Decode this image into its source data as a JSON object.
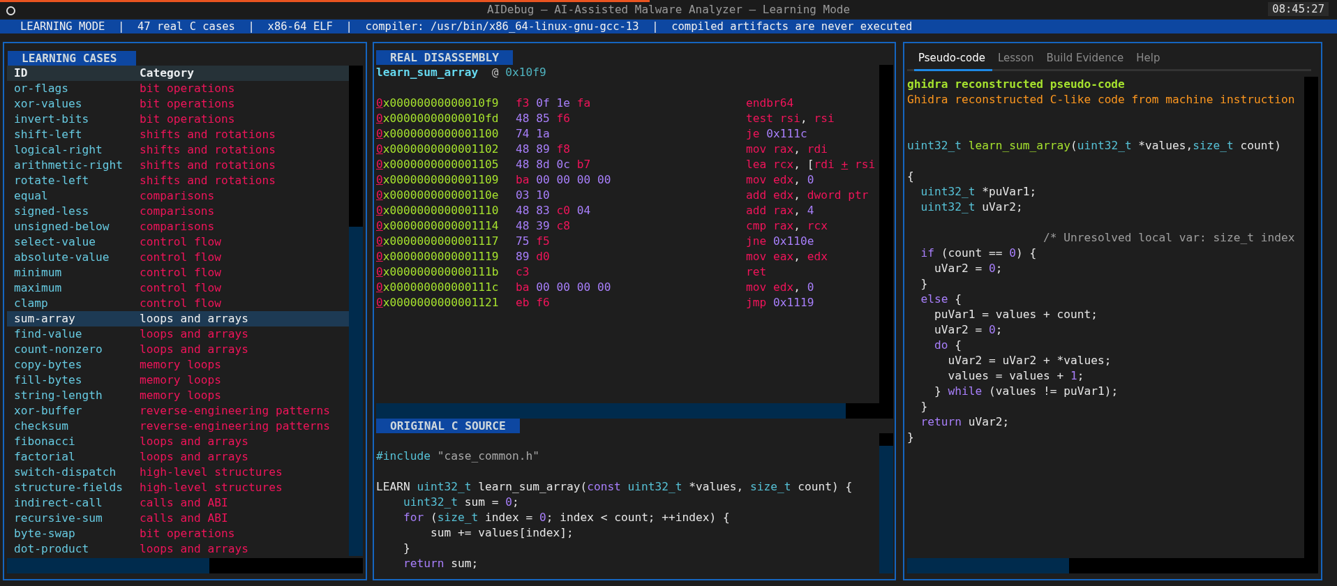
{
  "title_bar": {
    "title": "AIDebug — AI-Assisted Malware Analyzer — Learning Mode",
    "time": "08:45:27"
  },
  "status_bar": "LEARNING MODE  |  47 real C cases  |  x86-64 ELF  |  compiler: /usr/bin/x86_64-linux-gnu-gcc-13  |  compiled artifacts are never executed",
  "cases": {
    "title": "LEARNING CASES",
    "columns": [
      "ID",
      "Category"
    ],
    "rows": [
      {
        "id": "or-flags",
        "category": "bit operations",
        "selected": false
      },
      {
        "id": "xor-values",
        "category": "bit operations",
        "selected": false
      },
      {
        "id": "invert-bits",
        "category": "bit operations",
        "selected": false
      },
      {
        "id": "shift-left",
        "category": "shifts and rotations",
        "selected": false
      },
      {
        "id": "logical-right",
        "category": "shifts and rotations",
        "selected": false
      },
      {
        "id": "arithmetic-right",
        "category": "shifts and rotations",
        "selected": false
      },
      {
        "id": "rotate-left",
        "category": "shifts and rotations",
        "selected": false
      },
      {
        "id": "equal",
        "category": "comparisons",
        "selected": false
      },
      {
        "id": "signed-less",
        "category": "comparisons",
        "selected": false
      },
      {
        "id": "unsigned-below",
        "category": "comparisons",
        "selected": false
      },
      {
        "id": "select-value",
        "category": "control flow",
        "selected": false
      },
      {
        "id": "absolute-value",
        "category": "control flow",
        "selected": false
      },
      {
        "id": "minimum",
        "category": "control flow",
        "selected": false
      },
      {
        "id": "maximum",
        "category": "control flow",
        "selected": false
      },
      {
        "id": "clamp",
        "category": "control flow",
        "selected": false
      },
      {
        "id": "sum-array",
        "category": "loops and arrays",
        "selected": true
      },
      {
        "id": "find-value",
        "category": "loops and arrays",
        "selected": false
      },
      {
        "id": "count-nonzero",
        "category": "loops and arrays",
        "selected": false
      },
      {
        "id": "copy-bytes",
        "category": "memory loops",
        "selected": false
      },
      {
        "id": "fill-bytes",
        "category": "memory loops",
        "selected": false
      },
      {
        "id": "string-length",
        "category": "memory loops",
        "selected": false
      },
      {
        "id": "xor-buffer",
        "category": "reverse-engineering patterns",
        "selected": false
      },
      {
        "id": "checksum",
        "category": "reverse-engineering patterns",
        "selected": false
      },
      {
        "id": "fibonacci",
        "category": "loops and arrays",
        "selected": false
      },
      {
        "id": "factorial",
        "category": "loops and arrays",
        "selected": false
      },
      {
        "id": "switch-dispatch",
        "category": "high-level structures",
        "selected": false
      },
      {
        "id": "structure-fields",
        "category": "high-level structures",
        "selected": false
      },
      {
        "id": "indirect-call",
        "category": "calls and ABI",
        "selected": false
      },
      {
        "id": "recursive-sum",
        "category": "calls and ABI",
        "selected": false
      },
      {
        "id": "byte-swap",
        "category": "bit operations",
        "selected": false
      },
      {
        "id": "dot-product",
        "category": "loops and arrays",
        "selected": false
      }
    ]
  },
  "disassembly": {
    "title": "REAL DISASSEMBLY",
    "function": "learn_sum_array",
    "at": "@",
    "address": "0x10f9",
    "rows": [
      {
        "address": [
          {
            "text": "0",
            "kind": "mark"
          },
          {
            "text": "x00000000000010f9",
            "kind": "addr"
          }
        ],
        "bytes": [
          {
            "text": "f3",
            "kind": "op"
          },
          {
            "text": "0f",
            "kind": "num"
          },
          {
            "text": "1e",
            "kind": "num"
          },
          {
            "text": "fa",
            "kind": "op"
          }
        ],
        "instruction": [
          {
            "text": "endbr64",
            "kind": "op"
          }
        ]
      },
      {
        "address": [
          {
            "text": "0",
            "kind": "mark"
          },
          {
            "text": "x00000000000010fd",
            "kind": "addr"
          }
        ],
        "bytes": [
          {
            "text": "48",
            "kind": "num"
          },
          {
            "text": "85",
            "kind": "num"
          },
          {
            "text": "f6",
            "kind": "op"
          }
        ],
        "instruction": [
          {
            "text": "test rsi",
            "kind": "op"
          },
          {
            "text": ", ",
            "kind": "plain"
          },
          {
            "text": "rsi",
            "kind": "op"
          }
        ]
      },
      {
        "address": [
          {
            "text": "0",
            "kind": "mark"
          },
          {
            "text": "x0000000000001100",
            "kind": "addr"
          }
        ],
        "bytes": [
          {
            "text": "74",
            "kind": "num"
          },
          {
            "text": "1a",
            "kind": "num"
          }
        ],
        "instruction": [
          {
            "text": "je",
            "kind": "op"
          },
          {
            "text": " 0x111c",
            "kind": "num"
          }
        ]
      },
      {
        "address": [
          {
            "text": "0",
            "kind": "mark"
          },
          {
            "text": "x0000000000001102",
            "kind": "addr"
          }
        ],
        "bytes": [
          {
            "text": "48",
            "kind": "num"
          },
          {
            "text": "89",
            "kind": "num"
          },
          {
            "text": "f8",
            "kind": "op"
          }
        ],
        "instruction": [
          {
            "text": "mov rax",
            "kind": "op"
          },
          {
            "text": ", ",
            "kind": "plain"
          },
          {
            "text": "rdi",
            "kind": "op"
          }
        ]
      },
      {
        "address": [
          {
            "text": "0",
            "kind": "mark"
          },
          {
            "text": "x0000000000001105",
            "kind": "addr"
          }
        ],
        "bytes": [
          {
            "text": "48",
            "kind": "num"
          },
          {
            "text": "8d",
            "kind": "num"
          },
          {
            "text": "0c",
            "kind": "num"
          },
          {
            "text": "b7",
            "kind": "op"
          }
        ],
        "instruction": [
          {
            "text": "lea rcx",
            "kind": "op"
          },
          {
            "text": ", [",
            "kind": "plain"
          },
          {
            "text": "rdi ",
            "kind": "op"
          },
          {
            "text": "+",
            "kind": "mark"
          },
          {
            "text": " rsi",
            "kind": "op"
          }
        ]
      },
      {
        "address": [
          {
            "text": "0",
            "kind": "mark"
          },
          {
            "text": "x0000000000001109",
            "kind": "addr"
          }
        ],
        "bytes": [
          {
            "text": "ba",
            "kind": "op"
          },
          {
            "text": "00",
            "kind": "num"
          },
          {
            "text": "00",
            "kind": "num"
          },
          {
            "text": "00",
            "kind": "num"
          },
          {
            "text": "00",
            "kind": "num"
          }
        ],
        "instruction": [
          {
            "text": "mov edx",
            "kind": "op"
          },
          {
            "text": ", ",
            "kind": "plain"
          },
          {
            "text": "0",
            "kind": "num"
          }
        ]
      },
      {
        "address": [
          {
            "text": "0",
            "kind": "mark"
          },
          {
            "text": "x000000000000110e",
            "kind": "addr"
          }
        ],
        "bytes": [
          {
            "text": "03",
            "kind": "num"
          },
          {
            "text": "10",
            "kind": "num"
          }
        ],
        "instruction": [
          {
            "text": "add edx",
            "kind": "op"
          },
          {
            "text": ", ",
            "kind": "plain"
          },
          {
            "text": "dword ptr",
            "kind": "op"
          }
        ]
      },
      {
        "address": [
          {
            "text": "0",
            "kind": "mark"
          },
          {
            "text": "x0000000000001110",
            "kind": "addr"
          }
        ],
        "bytes": [
          {
            "text": "48",
            "kind": "num"
          },
          {
            "text": "83",
            "kind": "num"
          },
          {
            "text": "c0",
            "kind": "op"
          },
          {
            "text": "04",
            "kind": "num"
          }
        ],
        "instruction": [
          {
            "text": "add rax",
            "kind": "op"
          },
          {
            "text": ", ",
            "kind": "plain"
          },
          {
            "text": "4",
            "kind": "num"
          }
        ]
      },
      {
        "address": [
          {
            "text": "0",
            "kind": "mark"
          },
          {
            "text": "x0000000000001114",
            "kind": "addr"
          }
        ],
        "bytes": [
          {
            "text": "48",
            "kind": "num"
          },
          {
            "text": "39",
            "kind": "num"
          },
          {
            "text": "c8",
            "kind": "op"
          }
        ],
        "instruction": [
          {
            "text": "cmp rax",
            "kind": "op"
          },
          {
            "text": ", ",
            "kind": "plain"
          },
          {
            "text": "rcx",
            "kind": "op"
          }
        ]
      },
      {
        "address": [
          {
            "text": "0",
            "kind": "mark"
          },
          {
            "text": "x0000000000001117",
            "kind": "addr"
          }
        ],
        "bytes": [
          {
            "text": "75",
            "kind": "num"
          },
          {
            "text": "f5",
            "kind": "op"
          }
        ],
        "instruction": [
          {
            "text": "jne",
            "kind": "op"
          },
          {
            "text": " 0x110e",
            "kind": "num"
          }
        ]
      },
      {
        "address": [
          {
            "text": "0",
            "kind": "mark"
          },
          {
            "text": "x0000000000001119",
            "kind": "addr"
          }
        ],
        "bytes": [
          {
            "text": "89",
            "kind": "num"
          },
          {
            "text": "d0",
            "kind": "op"
          }
        ],
        "instruction": [
          {
            "text": "mov eax",
            "kind": "op"
          },
          {
            "text": ", ",
            "kind": "plain"
          },
          {
            "text": "edx",
            "kind": "op"
          }
        ]
      },
      {
        "address": [
          {
            "text": "0",
            "kind": "mark"
          },
          {
            "text": "x000000000000111b",
            "kind": "addr"
          }
        ],
        "bytes": [
          {
            "text": "c3",
            "kind": "op"
          }
        ],
        "instruction": [
          {
            "text": "ret",
            "kind": "op"
          }
        ]
      },
      {
        "address": [
          {
            "text": "0",
            "kind": "mark"
          },
          {
            "text": "x000000000000111c",
            "kind": "addr"
          }
        ],
        "bytes": [
          {
            "text": "ba",
            "kind": "op"
          },
          {
            "text": "00",
            "kind": "num"
          },
          {
            "text": "00",
            "kind": "num"
          },
          {
            "text": "00",
            "kind": "num"
          },
          {
            "text": "00",
            "kind": "num"
          }
        ],
        "instruction": [
          {
            "text": "mov edx",
            "kind": "op"
          },
          {
            "text": ", ",
            "kind": "plain"
          },
          {
            "text": "0",
            "kind": "num"
          }
        ]
      },
      {
        "address": [
          {
            "text": "0",
            "kind": "mark"
          },
          {
            "text": "x0000000000001121",
            "kind": "addr"
          }
        ],
        "bytes": [
          {
            "text": "eb",
            "kind": "op"
          },
          {
            "text": "f6",
            "kind": "op"
          }
        ],
        "instruction": [
          {
            "text": "jmp",
            "kind": "op"
          },
          {
            "text": " 0x1119",
            "kind": "num"
          }
        ]
      }
    ]
  },
  "source": {
    "title": "ORIGINAL C SOURCE",
    "lines": [
      {
        "kind": "code",
        "tokens": [
          {
            "text": "#include",
            "kind": "type"
          },
          {
            "text": " \"case_common.h\"",
            "kind": "str"
          }
        ]
      },
      {
        "kind": "blank"
      },
      {
        "kind": "code",
        "tokens": [
          {
            "text": "LEARN ",
            "kind": "plain"
          },
          {
            "text": "uint32_t",
            "kind": "type"
          },
          {
            "text": " learn_sum_array(",
            "kind": "plain"
          },
          {
            "text": "const",
            "kind": "kw"
          },
          {
            "text": " uint32_t",
            "kind": "type"
          },
          {
            "text": " *values, ",
            "kind": "plain"
          },
          {
            "text": "size_t",
            "kind": "type"
          },
          {
            "text": " count) {",
            "kind": "plain"
          }
        ]
      },
      {
        "kind": "code",
        "tokens": [
          {
            "text": "    uint32_t",
            "kind": "type"
          },
          {
            "text": " sum = ",
            "kind": "plain"
          },
          {
            "text": "0",
            "kind": "kw"
          },
          {
            "text": ";",
            "kind": "plain"
          }
        ]
      },
      {
        "kind": "code",
        "tokens": [
          {
            "text": "    for",
            "kind": "kw"
          },
          {
            "text": " (",
            "kind": "plain"
          },
          {
            "text": "size_t",
            "kind": "type"
          },
          {
            "text": " index = ",
            "kind": "plain"
          },
          {
            "text": "0",
            "kind": "kw"
          },
          {
            "text": "; index < count; ++index) {",
            "kind": "plain"
          }
        ]
      },
      {
        "kind": "code",
        "tokens": [
          {
            "text": "        sum += values[index];",
            "kind": "plain"
          }
        ]
      },
      {
        "kind": "code",
        "tokens": [
          {
            "text": "    }",
            "kind": "plain"
          }
        ]
      },
      {
        "kind": "code",
        "tokens": [
          {
            "text": "    return",
            "kind": "kw"
          },
          {
            "text": " sum;",
            "kind": "plain"
          }
        ]
      }
    ]
  },
  "tabs": [
    {
      "label": "Pseudo-code",
      "selected": true
    },
    {
      "label": "Lesson",
      "selected": false
    },
    {
      "label": "Build Evidence",
      "selected": false
    },
    {
      "label": "Help",
      "selected": false
    }
  ],
  "pseudo_code": {
    "lines": [
      {
        "kind": "code",
        "tokens": [
          {
            "text": "ghidra reconstructed pseudo-code",
            "kind": "heading"
          }
        ]
      },
      {
        "kind": "code",
        "tokens": [
          {
            "text": "Ghidra reconstructed C-like code from machine instruction",
            "kind": "note"
          }
        ]
      },
      {
        "kind": "blank"
      },
      {
        "kind": "blank"
      },
      {
        "kind": "code",
        "tokens": [
          {
            "text": "uint32_t",
            "kind": "type"
          },
          {
            "text": " learn_sum_array",
            "kind": "fn"
          },
          {
            "text": "(",
            "kind": "plain"
          },
          {
            "text": "uint32_t",
            "kind": "type"
          },
          {
            "text": " *values,",
            "kind": "plain"
          },
          {
            "text": "size_t",
            "kind": "type"
          },
          {
            "text": " count)",
            "kind": "plain"
          }
        ]
      },
      {
        "kind": "blank"
      },
      {
        "kind": "code",
        "tokens": [
          {
            "text": "{",
            "kind": "plain"
          }
        ]
      },
      {
        "kind": "code",
        "tokens": [
          {
            "text": "  uint32_t",
            "kind": "type"
          },
          {
            "text": " *puVar1;",
            "kind": "plain"
          }
        ]
      },
      {
        "kind": "code",
        "tokens": [
          {
            "text": "  uint32_t",
            "kind": "type"
          },
          {
            "text": " uVar2;",
            "kind": "plain"
          }
        ]
      },
      {
        "kind": "blank"
      },
      {
        "kind": "code",
        "tokens": [
          {
            "text": "                    /* Unresolved local var: size_t index",
            "kind": "comment"
          }
        ]
      },
      {
        "kind": "code",
        "tokens": [
          {
            "text": "  if",
            "kind": "kw"
          },
          {
            "text": " (count == ",
            "kind": "plain"
          },
          {
            "text": "0",
            "kind": "kw"
          },
          {
            "text": ") {",
            "kind": "plain"
          }
        ]
      },
      {
        "kind": "code",
        "tokens": [
          {
            "text": "    uVar2 = ",
            "kind": "plain"
          },
          {
            "text": "0",
            "kind": "kw"
          },
          {
            "text": ";",
            "kind": "plain"
          }
        ]
      },
      {
        "kind": "code",
        "tokens": [
          {
            "text": "  }",
            "kind": "plain"
          }
        ]
      },
      {
        "kind": "code",
        "tokens": [
          {
            "text": "  else",
            "kind": "kw"
          },
          {
            "text": " {",
            "kind": "plain"
          }
        ]
      },
      {
        "kind": "code",
        "tokens": [
          {
            "text": "    puVar1 = values + count;",
            "kind": "plain"
          }
        ]
      },
      {
        "kind": "code",
        "tokens": [
          {
            "text": "    uVar2 = ",
            "kind": "plain"
          },
          {
            "text": "0",
            "kind": "kw"
          },
          {
            "text": ";",
            "kind": "plain"
          }
        ]
      },
      {
        "kind": "code",
        "tokens": [
          {
            "text": "    do",
            "kind": "kw"
          },
          {
            "text": " {",
            "kind": "plain"
          }
        ]
      },
      {
        "kind": "code",
        "tokens": [
          {
            "text": "      uVar2 = uVar2 + *values;",
            "kind": "plain"
          }
        ]
      },
      {
        "kind": "code",
        "tokens": [
          {
            "text": "      values = values + ",
            "kind": "plain"
          },
          {
            "text": "1",
            "kind": "kw"
          },
          {
            "text": ";",
            "kind": "plain"
          }
        ]
      },
      {
        "kind": "code",
        "tokens": [
          {
            "text": "    } ",
            "kind": "plain"
          },
          {
            "text": "while",
            "kind": "kw"
          },
          {
            "text": " (values != puVar1);",
            "kind": "plain"
          }
        ]
      },
      {
        "kind": "code",
        "tokens": [
          {
            "text": "  }",
            "kind": "plain"
          }
        ]
      },
      {
        "kind": "code",
        "tokens": [
          {
            "text": "  return",
            "kind": "kw"
          },
          {
            "text": " uVar2;",
            "kind": "plain"
          }
        ]
      },
      {
        "kind": "code",
        "tokens": [
          {
            "text": "}",
            "kind": "plain"
          }
        ]
      }
    ]
  }
}
